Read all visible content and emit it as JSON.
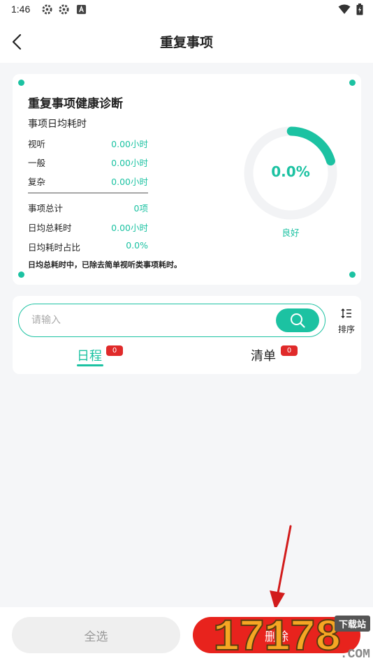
{
  "status_bar": {
    "time": "1:46",
    "icons": [
      "gear-icon",
      "gear-icon",
      "a-icon"
    ],
    "right_icons": [
      "wifi-icon",
      "battery-icon"
    ]
  },
  "header": {
    "title": "重复事项",
    "back_icon": "chevron-left-icon"
  },
  "diagnosis": {
    "title": "重复事项健康诊断",
    "subtitle": "事项日均耗时",
    "rows": [
      {
        "label": "视听",
        "value": "0.00小时"
      },
      {
        "label": "一般",
        "value": "0.00小时"
      },
      {
        "label": "复杂",
        "value": "0.00小时"
      }
    ],
    "summary": [
      {
        "label": "事项总计",
        "value": "0项"
      },
      {
        "label": "日均总耗时",
        "value": "0.00小时"
      },
      {
        "label": "日均耗时占比",
        "value": "0.0%"
      }
    ],
    "note": "日均总耗时中，已除去简单视听类事项耗时。",
    "gauge": {
      "value_text": "0.0%",
      "status": "良好",
      "arc_fraction": 0.2
    },
    "accent_color": "#1cc2a2"
  },
  "search": {
    "placeholder": "请输入",
    "value": "",
    "sort_label": "排序"
  },
  "tabs": [
    {
      "label": "日程",
      "badge": "0",
      "active": true
    },
    {
      "label": "清单",
      "badge": "0",
      "active": false
    }
  ],
  "actions": {
    "select_all": "全选",
    "delete": "删除",
    "delete_color": "#e8231d"
  },
  "watermark": {
    "number": "17178",
    "tag": "下载站",
    "domain": ".COM"
  }
}
